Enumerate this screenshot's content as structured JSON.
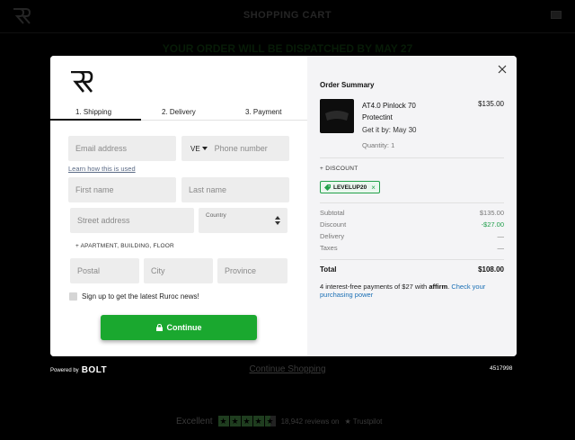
{
  "background": {
    "title": "SHOPPING CART",
    "dispatch_message": "YOUR ORDER WILL BE DISPATCHED BY MAY 27",
    "continue_shopping": "Continue Shopping",
    "order_id": "4517998",
    "trustpilot": {
      "rating_label": "Excellent",
      "stars": 4.5,
      "reviews": "18,942 reviews on",
      "brand": "Trustpilot"
    }
  },
  "checkout": {
    "tabs": [
      "1. Shipping",
      "2. Delivery",
      "3. Payment"
    ],
    "active_tab": 0,
    "fields": {
      "email_placeholder": "Email address",
      "country_code": "VE",
      "phone_placeholder": "Phone number",
      "learn_link": "Learn how this is used",
      "first_name_placeholder": "First name",
      "last_name_placeholder": "Last name",
      "street_placeholder": "Street address",
      "country_label": "Country",
      "apartment_link": "+ APARTMENT, BUILDING, FLOOR",
      "postal_placeholder": "Postal",
      "city_placeholder": "City",
      "province_placeholder": "Province"
    },
    "newsletter_label": "Sign up to get the latest Ruroc news!",
    "continue_label": "Continue"
  },
  "summary": {
    "title": "Order Summary",
    "product": {
      "name": "AT4.0 Pinlock 70 Protectint",
      "price": "$135.00",
      "shipping": "Get it by: May 30",
      "quantity": "Quantity: 1"
    },
    "discount_label": "+ DISCOUNT",
    "coupon_code": "LEVELUP20",
    "lines": [
      {
        "label": "Subtotal",
        "value": "$135.00"
      },
      {
        "label": "Discount",
        "value": "-$27.00"
      },
      {
        "label": "Delivery",
        "value": "—"
      },
      {
        "label": "Taxes",
        "value": "—"
      }
    ],
    "total_label": "Total",
    "total_value": "$108.00",
    "affirm": {
      "text": "4 interest-free payments of $27 with",
      "brand": "affirm",
      "cta": "Check your purchasing power"
    }
  },
  "footer": {
    "powered_by": "Powered by",
    "bolt": "BOLT"
  },
  "colors": {
    "accent_green": "#1aa82f",
    "discount_green": "#1f9e4a",
    "link_blue": "#1a6fb5"
  }
}
